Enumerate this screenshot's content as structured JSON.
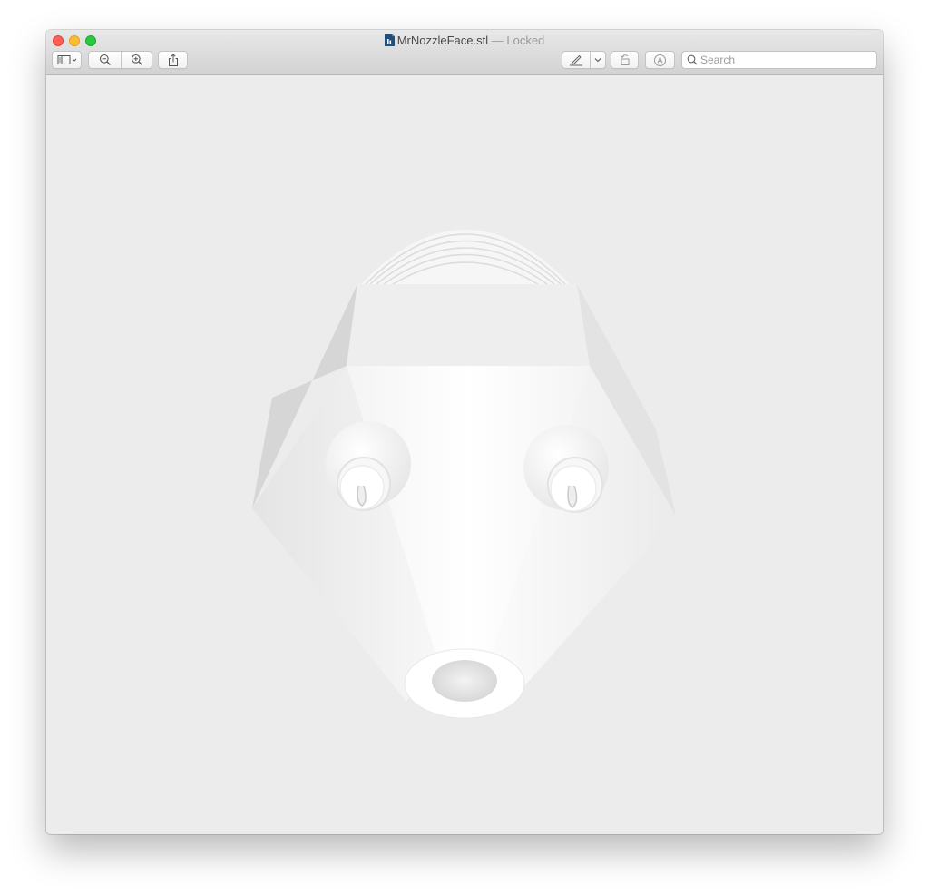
{
  "window": {
    "filename": "MrNozzleFace.stl",
    "separator": " — ",
    "state": "Locked"
  },
  "toolbar": {
    "buttons": [
      {
        "name": "sidebar-toggle-button",
        "icon": "sidebar-icon"
      },
      {
        "name": "zoom-out-button",
        "icon": "zoom-out-icon"
      },
      {
        "name": "zoom-in-button",
        "icon": "zoom-in-icon"
      },
      {
        "name": "share-button",
        "icon": "share-icon"
      },
      {
        "name": "markup-button",
        "icon": "pen-icon"
      },
      {
        "name": "rotate-button",
        "icon": "rotate-icon"
      },
      {
        "name": "annotate-button",
        "icon": "markup-circle-icon"
      }
    ],
    "search_placeholder": "Search"
  },
  "viewer": {
    "content": "3D model preview",
    "colors": {
      "background": "#ececec",
      "model_light": "#ffffff",
      "model_shade": "#d9d9d9"
    }
  },
  "colors": {
    "close": "#fe5f57",
    "minimize": "#febc2e",
    "zoom": "#28c840"
  }
}
